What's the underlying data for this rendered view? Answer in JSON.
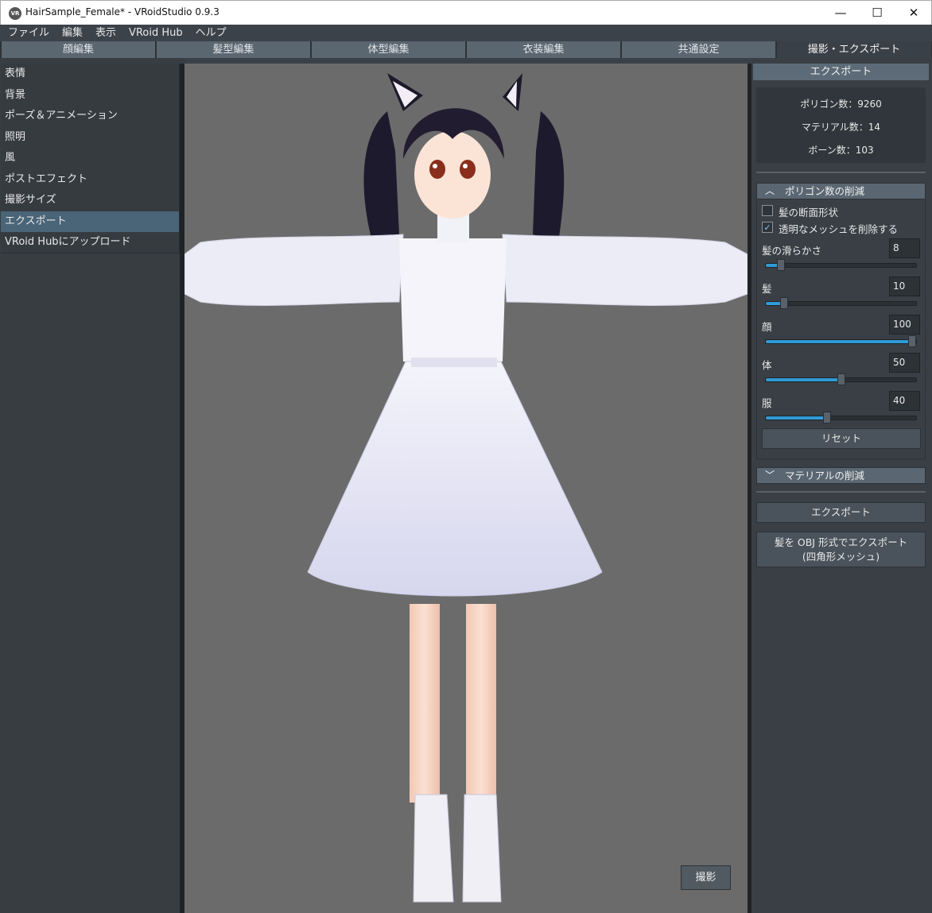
{
  "window": {
    "title": "HairSample_Female* - VRoidStudio 0.9.3",
    "app_icon_text": "VR",
    "minimize": "—",
    "maximize": "☐",
    "close": "✕"
  },
  "menu": [
    "ファイル",
    "編集",
    "表示",
    "VRoid Hub",
    "ヘルプ"
  ],
  "tabs": [
    "顔編集",
    "髪型編集",
    "体型編集",
    "衣装編集",
    "共通設定",
    "撮影・エクスポート"
  ],
  "active_tab": "撮影・エクスポート",
  "sidebar": {
    "items": [
      "表情",
      "背景",
      "ポーズ＆アニメーション",
      "照明",
      "風",
      "ポストエフェクト",
      "撮影サイズ",
      "エクスポート",
      "VRoid Hubにアップロード"
    ],
    "active": "エクスポート"
  },
  "viewport": {
    "shoot_button": "撮影",
    "background_color": "#6b6b6b"
  },
  "export_panel": {
    "header": "エクスポート",
    "stats": {
      "polygons": "ポリゴン数：9260",
      "materials": "マテリアル数：14",
      "bones": "ボーン数：103"
    },
    "polygon_reduction": {
      "header": "ポリゴン数の削減",
      "expanded": true,
      "checkboxes": [
        {
          "label": "髪の断面形状",
          "checked": false
        },
        {
          "label": "透明なメッシュを削除する",
          "checked": true
        }
      ],
      "sliders": [
        {
          "label": "髪の滑らかさ",
          "value": "8",
          "fraction": 0.08
        },
        {
          "label": "髪",
          "value": "10",
          "fraction": 0.1
        },
        {
          "label": "顔",
          "value": "100",
          "fraction": 1.0
        },
        {
          "label": "体",
          "value": "50",
          "fraction": 0.5
        },
        {
          "label": "服",
          "value": "40",
          "fraction": 0.4
        }
      ],
      "reset_button": "リセット"
    },
    "material_reduction": {
      "header": "マテリアルの削減",
      "expanded": false
    },
    "export_button": "エクスポート",
    "obj_export_button_line1": "髪を OBJ 形式でエクスポート",
    "obj_export_button_line2": "(四角形メッシュ)"
  },
  "colors": {
    "accent": "#2f9bd7",
    "panel_bg": "#393f45",
    "selected_item": "#4a6478"
  }
}
